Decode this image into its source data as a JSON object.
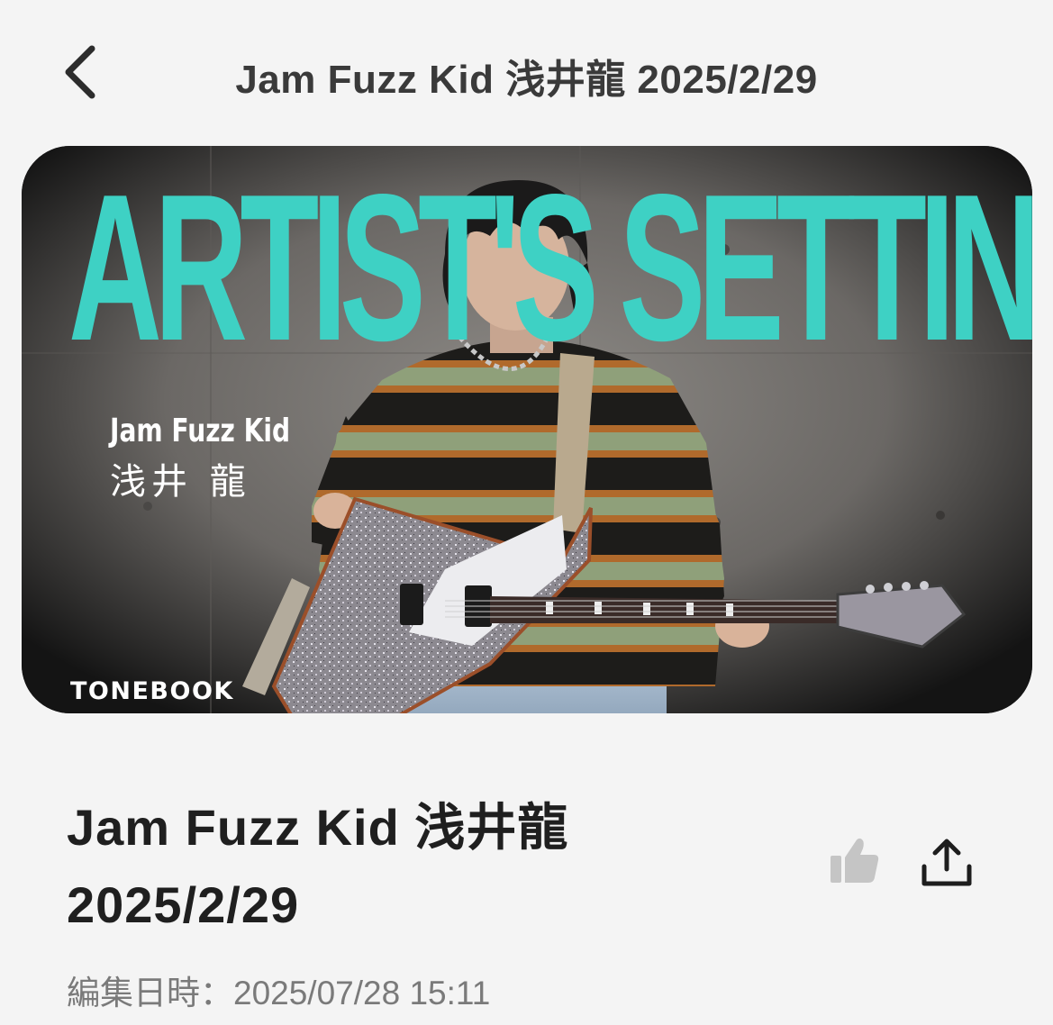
{
  "header": {
    "title": "Jam Fuzz Kid 浅井龍 2025/2/29",
    "back_icon": "chevron-left-icon"
  },
  "banner": {
    "headline": "ARTIST'S SETTINGS",
    "band_name": "Jam Fuzz Kid",
    "artist_name": "浅井 龍",
    "brand": "TONEBOOK",
    "accent_color": "#3ed1c4"
  },
  "article": {
    "title_line1": "Jam Fuzz Kid 浅井龍",
    "title_line2": "2025/2/29",
    "edit_label": "編集日時：",
    "edit_datetime": "2025/07/28 15:11",
    "like_icon": "thumbs-up-icon",
    "share_icon": "share-upload-icon"
  }
}
